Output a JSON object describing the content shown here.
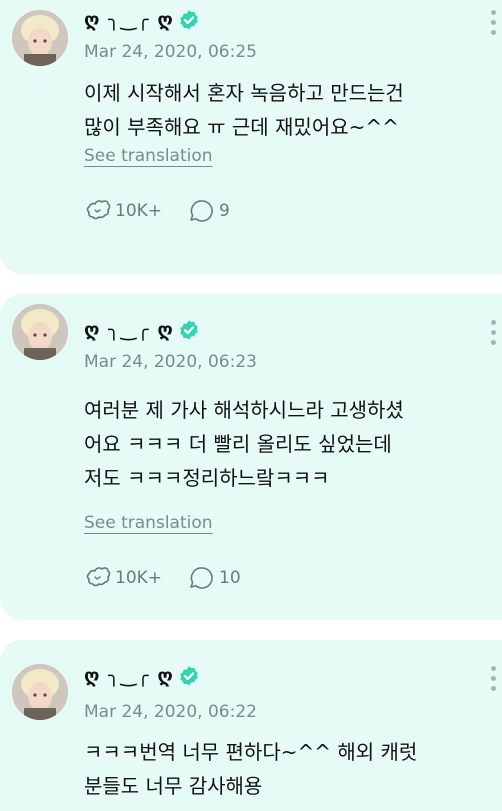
{
  "posts": [
    {
      "author": "ღ ╮‿╭ ღ",
      "timestamp": "Mar 24, 2020, 06:25",
      "text": "이제 시작해서 혼자 녹음하고 만드는건\n많이 부족해요 ㅠ 근데 재밌어요~^^",
      "translate_label": "See translation",
      "likes": "10K+",
      "comments": "9"
    },
    {
      "author": "ღ ╮‿╭ ღ",
      "timestamp": "Mar 24, 2020, 06:23",
      "text": "여러분 제 가사 해석하시느라 고생하셨\n어요 ㅋㅋㅋ 더 빨리 올리도 싶었는데\n저도 ㅋㅋㅋ정리하느랔ㅋㅋㅋ",
      "translate_label": "See translation",
      "likes": "10K+",
      "comments": "10"
    },
    {
      "author": "ღ ╮‿╭ ღ",
      "timestamp": "Mar 24, 2020, 06:22",
      "text": "ㅋㅋㅋ번역 너무 편하다~^^ 해외 캐럿\n분들도 너무 감사해용"
    }
  ],
  "colors": {
    "card_background": "#e7fbf6",
    "verified_badge": "#32d4b4",
    "muted_text": "#7d8a8a"
  },
  "icons": [
    "avatar",
    "verified-badge-icon",
    "more-options-icon",
    "like-icon",
    "comment-icon"
  ]
}
